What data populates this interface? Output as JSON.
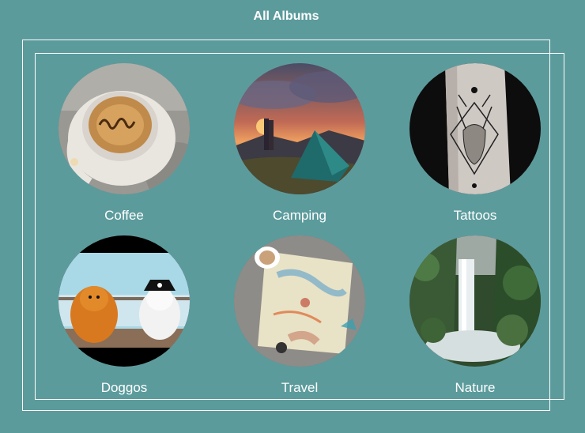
{
  "page": {
    "title": "All Albums"
  },
  "albums": [
    {
      "label": "Coffee",
      "image": "coffee-cup-photo"
    },
    {
      "label": "Camping",
      "image": "tent-sunset-photo"
    },
    {
      "label": "Tattoos",
      "image": "arm-tattoo-photo"
    },
    {
      "label": "Doggos",
      "image": "pomeranian-dogs-photo"
    },
    {
      "label": "Travel",
      "image": "map-planning-photo"
    },
    {
      "label": "Nature",
      "image": "waterfall-forest-photo"
    }
  ],
  "colors": {
    "background": "#5c9b9c",
    "text": "#ffffff",
    "frame": "#ffffff"
  }
}
